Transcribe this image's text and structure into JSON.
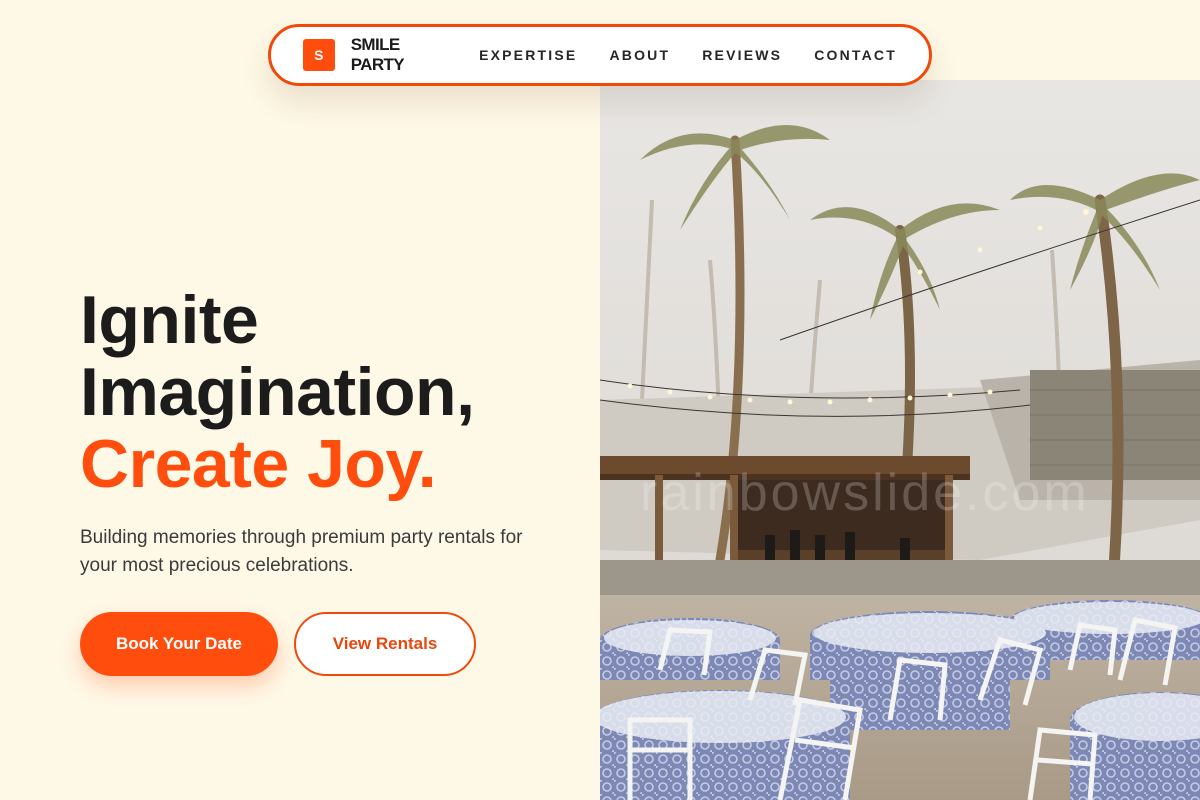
{
  "nav": {
    "brand_mark": "S",
    "brand_name": "SMILE PARTY",
    "links": [
      "EXPERTISE",
      "ABOUT",
      "REVIEWS",
      "CONTACT"
    ]
  },
  "hero": {
    "headline": [
      "Ignite",
      "Imagination,",
      "Create Joy."
    ],
    "subtext": "Building memories through premium party rentals for your most precious celebrations.",
    "primary_cta": "Book Your Date",
    "secondary_cta": "View Rentals",
    "image_watermark": "rainbowslide.com"
  },
  "colors": {
    "accent": "#ff4d0d",
    "background": "#fef8e6",
    "text": "#1c1c1c"
  },
  "icons": {
    "brand": "brand-logo-icon"
  }
}
